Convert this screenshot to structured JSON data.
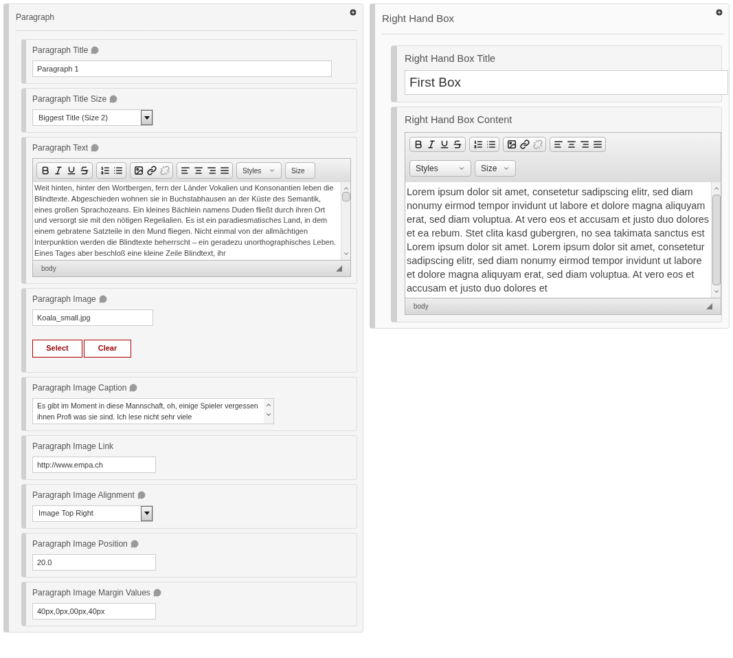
{
  "panels": [
    {
      "title": "Paragraph",
      "fields": [
        {
          "kind": "text",
          "label": "Paragraph Title",
          "help": true,
          "value": "Paragraph 1"
        },
        {
          "kind": "select",
          "label": "Paragraph Title Size",
          "help": true,
          "value": "Biggest Title (Size 2)"
        },
        {
          "kind": "editor",
          "label": "Paragraph Text",
          "help": true,
          "styles": "Styles",
          "size": "Size",
          "content": "Weit hinten, hinter den Wortbergen, fern der Länder Vokalien und Konsonantien leben die Blindtexte. Abgeschieden wohnen sie in Buchstabhausen an der Küste des Semantik, eines großen Sprachozeans. Ein kleines Bächlein namens Duden fließt durch ihren Ort und versorgt sie mit den nötigen Regelialien. Es ist ein paradiesmatisches Land, in dem einem gebratene Satzteile in den Mund fliegen. Nicht einmal von der allmächtigen Interpunktion werden die Blindtexte beherrscht – ein geradezu unorthographisches Leben. Eines Tages aber beschloß eine kleine Zeile Blindtext, ihr",
          "path": "body"
        },
        {
          "kind": "image",
          "label": "Paragraph Image",
          "help": true,
          "value": "Koala_small.jpg",
          "buttons": [
            "Select",
            "Clear"
          ]
        },
        {
          "kind": "textarea",
          "label": "Paragraph Image Caption",
          "help": true,
          "value": "Es gibt im Moment in diese Mannschaft, oh, einige Spieler vergessen ihnen Profi was sie sind. Ich lese nicht sehr viele"
        },
        {
          "kind": "text",
          "label": "Paragraph Image Link",
          "help": false,
          "value": "http://www.empa.ch"
        },
        {
          "kind": "select",
          "label": "Paragraph Image Alignment",
          "help": true,
          "value": "Image Top Right"
        },
        {
          "kind": "text",
          "label": "Paragraph Image Position",
          "help": true,
          "value": "20.0"
        },
        {
          "kind": "text",
          "label": "Paragraph Image Margin Values",
          "help": true,
          "value": "40px,0px,00px,40px"
        }
      ]
    },
    {
      "title": "Right Hand Box",
      "fields": [
        {
          "kind": "text",
          "label": "Right Hand Box Title",
          "help": false,
          "value": "First Box"
        },
        {
          "kind": "editor",
          "label": "Right Hand Box Content",
          "help": false,
          "styles": "Styles",
          "size": "Size",
          "content": "Lorem ipsum dolor sit amet, consetetur sadipscing elitr, sed diam nonumy eirmod tempor invidunt ut labore et dolore magna aliquyam erat, sed diam voluptua. At vero eos et accusam et justo duo dolores et ea rebum. Stet clita kasd gubergren, no sea takimata sanctus est Lorem ipsum dolor sit amet. Lorem ipsum dolor sit amet, consetetur sadipscing elitr, sed diam nonumy eirmod tempor invidunt ut labore et dolore magna aliquyam erat, sed diam voluptua. At vero eos et accusam et justo duo dolores et",
          "path": "body"
        }
      ]
    }
  ]
}
